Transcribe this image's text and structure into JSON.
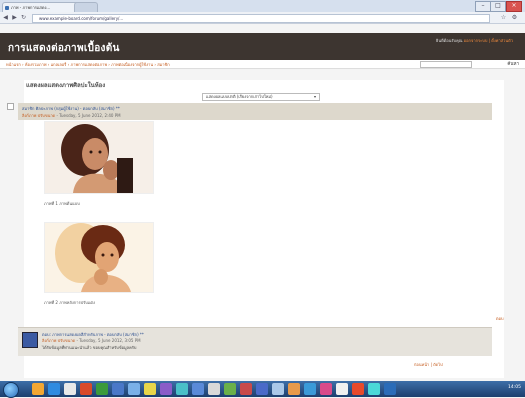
{
  "browser": {
    "tabs": [
      {
        "label": "ภาพ - ภาพการแสดง..."
      },
      {
        "label": ""
      }
    ],
    "url": "www.example-board.com/forum/gallery/..."
  },
  "site": {
    "title": "การแสดงต่อภาพเบื้องต้น",
    "user_links": {
      "prefix": "ยินดีต้อนรับคุณ",
      "highlight": "ออกจากระบบ | ตั้งค่าส่วนตัว"
    },
    "breadcrumbs": "หน้าแรก › ห้องรวมภาพ › แกลเลอรี่ › ภาพการแสดงต่อภาพ › ภาพต่อเนื่องจากผู้ใช้งาน › สมาชิก",
    "search_button": "ค้นหา"
  },
  "main": {
    "page_title": "แสดงผลแสดงภาพศิลปะในห้อง",
    "filter": "แสดงผลแบบปกติ (เรียงจากเก่าไปใหม่)",
    "post": {
      "user": "สมาชิก ศิลปะภาพ (กลุ่มผู้ใช้งาน) - ตอบกลับ (สมาชิก) **",
      "meta_link": "ลิงก์ภาพ ปรับขนาด",
      "meta_date": "- Tuesday, 5 June 2012, 2:40 PM",
      "captions": [
        "ภาพที่ 1 ภาพต้นแบบ",
        "ภาพที่ 2 ภาพหลังการปรับแต่ง"
      ],
      "report": "ตอบ"
    },
    "reply": {
      "user": "ตอบ: ภาพการแสดงผลสีสำหรับภาพ - ตอบกลับ (สมาชิก) **",
      "meta_link": "ลิงก์ภาพ ปรับขนาด",
      "meta_date": "- Tuesday, 5 June 2012, 3:05 PM",
      "text": "ได้รับข้อมูลที่ท่านแนะนำแล้ว ขอบคุณสำหรับข้อมูลครับ"
    },
    "pagination": "ก่อนหน้า | ถัดไป"
  },
  "taskbar": {
    "time": "14:05"
  },
  "colors": {
    "header_bg": "#3d3530",
    "accent": "#c45a1c",
    "post_header_bg": "#ddd8cc"
  }
}
